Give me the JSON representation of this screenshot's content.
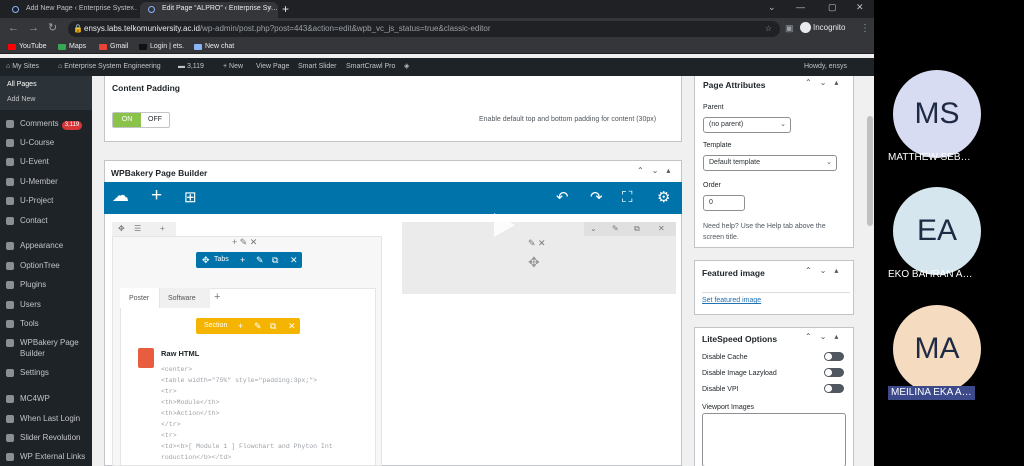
{
  "browser": {
    "tabs": [
      {
        "title": "Add New Page ‹ Enterprise Syste…",
        "close": "×"
      },
      {
        "title": "Edit Page “ALPRO” ‹ Enterprise Sy…",
        "close": "×"
      }
    ],
    "new_tab": "+",
    "window_controls": [
      "⌄",
      "—",
      "▢",
      "✕"
    ],
    "nav": {
      "back": "←",
      "forward": "→",
      "reload": "↻"
    },
    "url_host": "ensys.labs.telkomuniversity.ac.id",
    "url_path": "/wp-admin/post.php?post=443&action=edit&wpb_vc_js_status=true&classic-editor",
    "star": "☆",
    "incognito": "Incognito",
    "menu": "⋮",
    "bookmarks": [
      {
        "label": "YouTube",
        "color": "#ff0000"
      },
      {
        "label": "Maps",
        "color": "#34a853"
      },
      {
        "label": "Gmail",
        "color": "#ea4335"
      },
      {
        "label": "Login | ets.",
        "color": "#111111"
      },
      {
        "label": "New chat",
        "color": "#8ab4f8"
      }
    ]
  },
  "adminbar": {
    "my_sites": "My Sites",
    "site_name": "Enterprise System Engineering",
    "comments": "3,119",
    "new": "+ New",
    "view_page": "View Page",
    "smart_slider": "Smart Slider",
    "smartcrawl": "SmartCrawl Pro",
    "howdy": "Howdy, ensys"
  },
  "sidebar": {
    "submenu": [
      "All Pages",
      "Add New"
    ],
    "items": [
      {
        "label": "Comments",
        "badge": "3,119"
      },
      {
        "label": "U-Course"
      },
      {
        "label": "U-Event"
      },
      {
        "label": "U-Member"
      },
      {
        "label": "U-Project"
      },
      {
        "label": "Contact"
      },
      {
        "label": "Appearance"
      },
      {
        "label": "OptionTree"
      },
      {
        "label": "Plugins"
      },
      {
        "label": "Users"
      },
      {
        "label": "Tools"
      },
      {
        "label": "WPBakery Page Builder"
      },
      {
        "label": "Settings"
      },
      {
        "label": "MC4WP"
      },
      {
        "label": "When Last Login"
      },
      {
        "label": "Slider Revolution"
      },
      {
        "label": "WP External Links"
      }
    ]
  },
  "content_padding": {
    "title": "Content Padding",
    "on": "ON",
    "off": "OFF",
    "description": "Enable default top and bottom padding for content (30px)"
  },
  "wpbakery": {
    "title": "WPBakery Page Builder",
    "tabs_label": "Tabs",
    "tab_names": [
      "Poster",
      "Software"
    ],
    "section_label": "Section",
    "raw_html_title": "Raw HTML",
    "code_lines": [
      "<center>",
      "<table width=\"75%\" style=\"padding:3px;\">",
      "<tr>",
      "<th>Module</th>",
      "<th>Action</th>",
      "</tr>",
      "<tr>",
      "<td><b>[ Module 1 ] Flowchart and Phyton Int",
      "roduction</b></td>"
    ]
  },
  "page_attributes": {
    "title": "Page Attributes",
    "parent_label": "Parent",
    "parent_value": "(no parent)",
    "template_label": "Template",
    "template_value": "Default template",
    "order_label": "Order",
    "order_value": "0",
    "help": "Need help? Use the Help tab above the screen title."
  },
  "featured_image": {
    "title": "Featured image",
    "link": "Set featured image"
  },
  "litespeed": {
    "title": "LiteSpeed Options",
    "options": [
      "Disable Cache",
      "Disable Image Lazyload",
      "Disable VPI"
    ],
    "viewport_label": "Viewport Images"
  },
  "participants": [
    {
      "initials": "MS",
      "name": "MATTHEW SEB…",
      "color": "#d8dcf2"
    },
    {
      "initials": "EA",
      "name": "EKO BAHRAN A…",
      "color": "#d5e6ee"
    },
    {
      "initials": "MA",
      "name": "MEILINA EKA A…",
      "color": "#f5dcc0"
    }
  ]
}
